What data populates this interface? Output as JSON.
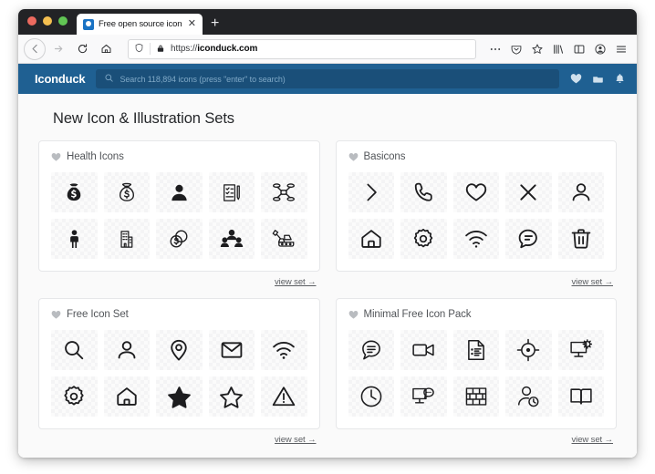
{
  "browser": {
    "tab": {
      "title": "Free open source icons, illustra",
      "favicon": "duck-favicon",
      "close_label": "✕"
    },
    "new_tab_label": "+",
    "nav": {
      "back": "back-arrow",
      "forward": "forward-arrow",
      "reload": "reload-arrow",
      "home": "home-icon"
    },
    "url": {
      "protocol": "https://",
      "host": "iconduck.com",
      "full": "https://iconduck.com",
      "shield_icon": "tracking-protection-shield",
      "lock_icon": "padlock-icon"
    },
    "toolbar_icons": [
      "page-actions-ellipsis",
      "pocket-icon",
      "bookmark-star-icon",
      "library-icon",
      "sidebar-icon",
      "account-icon",
      "app-menu-icon"
    ],
    "traffic_lights": [
      "close",
      "minimize",
      "maximize"
    ]
  },
  "site": {
    "logo": "Iconduck",
    "search": {
      "placeholder": "Search 118,894 icons (press \"enter\" to search)",
      "value": "",
      "icon": "search-icon"
    },
    "header_icons": [
      "heart-icon",
      "collection-icon",
      "bell-icon"
    ]
  },
  "main": {
    "page_title": "New Icon & Illustration Sets",
    "view_set_label": "view set →",
    "cards": [
      {
        "title": "Health Icons",
        "favorite_icon": "heart-icon",
        "icons": [
          "money-bag-filled-icon",
          "money-bag-outline-icon",
          "person-filled-icon",
          "clipboard-checklist-icon",
          "drone-icon",
          "standing-person-icon",
          "office-building-icon",
          "coins-dollar-icon",
          "group-people-icon",
          "excavator-icon"
        ]
      },
      {
        "title": "Basicons",
        "favorite_icon": "heart-icon",
        "icons": [
          "chevron-right-icon",
          "phone-icon",
          "heart-outline-icon",
          "close-x-icon",
          "user-icon",
          "home-icon",
          "gear-icon",
          "wifi-icon",
          "chat-bubble-icon",
          "trash-icon"
        ]
      },
      {
        "title": "Free Icon Set",
        "favorite_icon": "heart-icon",
        "icons": [
          "search-icon",
          "user-icon",
          "map-pin-icon",
          "envelope-icon",
          "wifi-icon",
          "gear-icon",
          "home-icon",
          "star-filled-icon",
          "star-outline-icon",
          "warning-triangle-icon"
        ]
      },
      {
        "title": "Minimal Free Icon Pack",
        "favorite_icon": "heart-icon",
        "icons": [
          "chat-lines-icon",
          "video-camera-icon",
          "document-list-icon",
          "crosshair-target-icon",
          "monitor-settings-icon",
          "clock-icon",
          "monitor-chat-icon",
          "brick-wall-icon",
          "user-clock-icon",
          "open-book-icon"
        ]
      }
    ]
  },
  "colors": {
    "header_blue": "#1f6092",
    "search_blue": "#1a4f79",
    "titlebar": "#222326",
    "page_bg": "#fafafa",
    "card_bg": "#ffffff"
  }
}
